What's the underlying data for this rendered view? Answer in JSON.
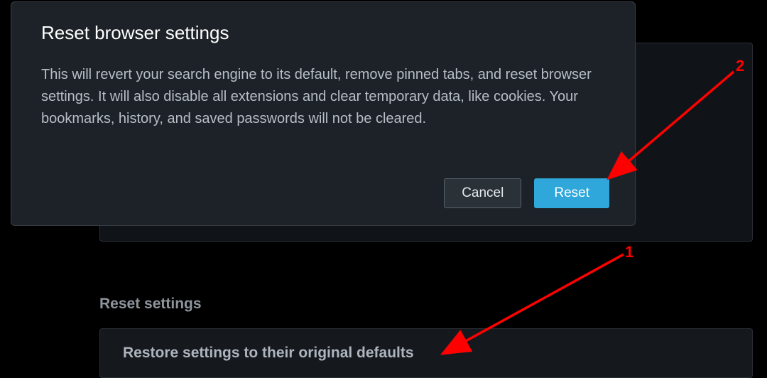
{
  "dialog": {
    "title": "Reset browser settings",
    "body": "This will revert your search engine to its default, remove pinned tabs, and reset browser settings. It will also disable all extensions and clear temporary data, like cookies. Your bookmarks, history, and saved passwords will not be cleared.",
    "cancel_label": "Cancel",
    "reset_label": "Reset"
  },
  "settings": {
    "section_title": "Reset settings",
    "restore_label": "Restore settings to their original defaults"
  },
  "annotations": {
    "label1": "1",
    "label2": "2"
  }
}
